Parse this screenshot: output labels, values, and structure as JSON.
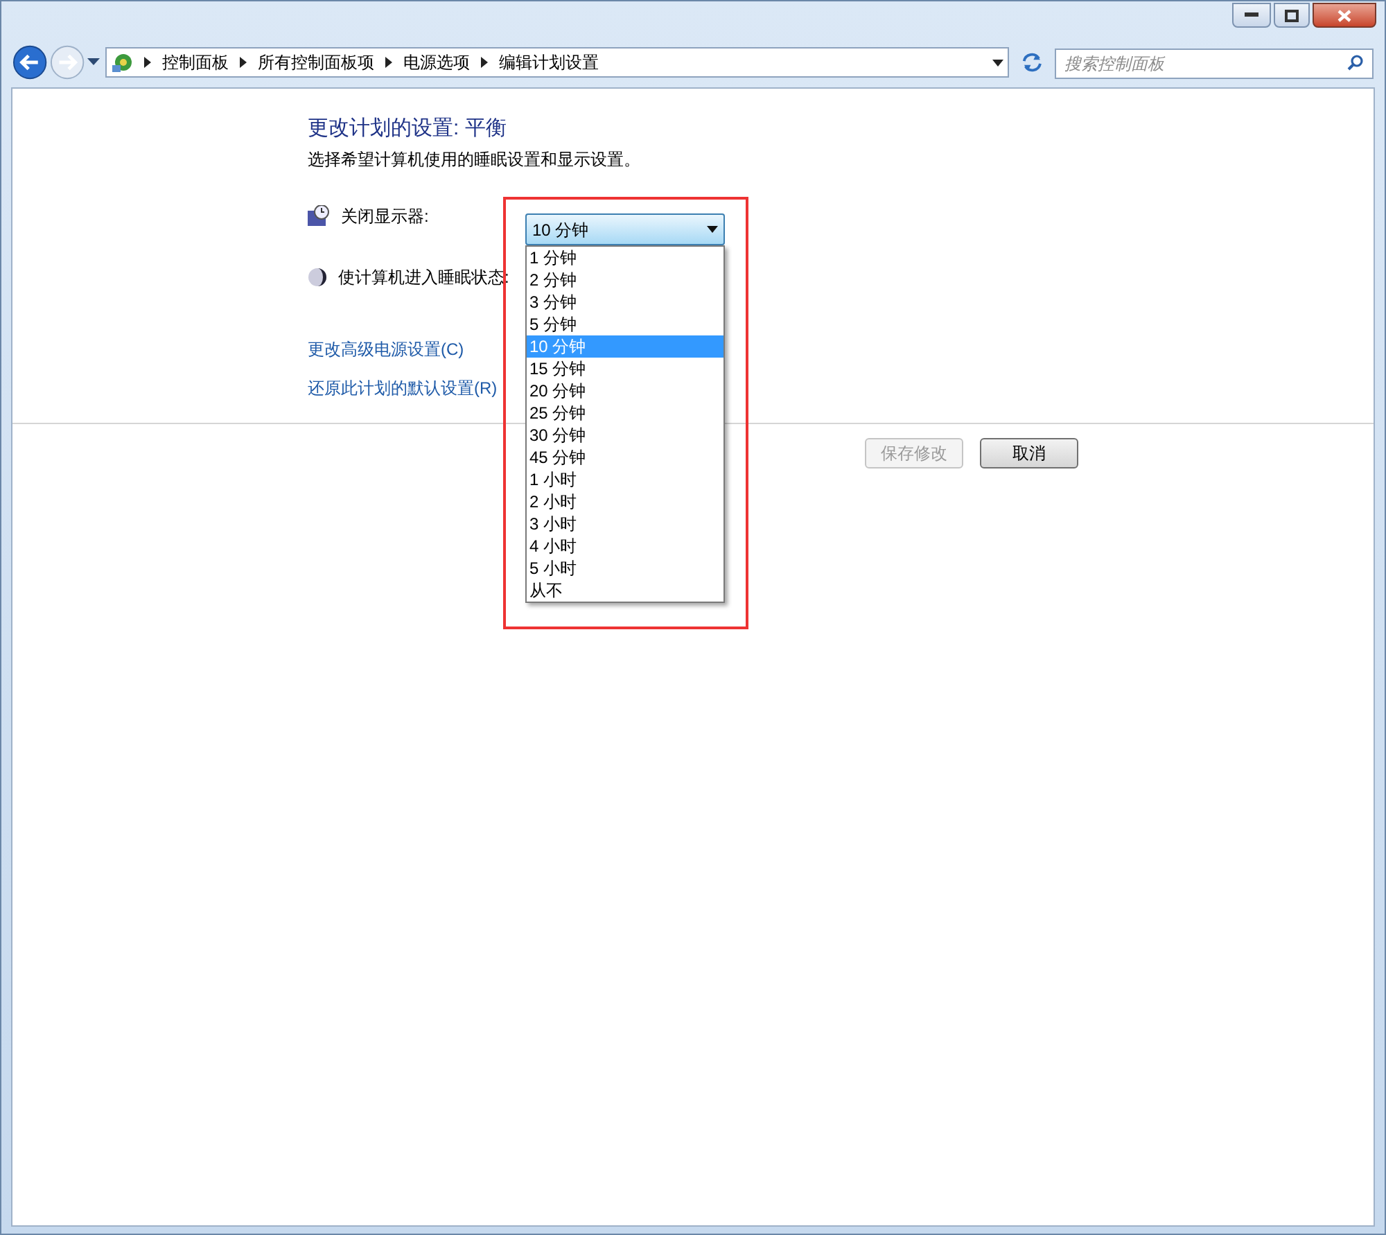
{
  "address_bar": {
    "crumbs": [
      "控制面板",
      "所有控制面板项",
      "电源选项",
      "编辑计划设置"
    ]
  },
  "search": {
    "placeholder": "搜索控制面板"
  },
  "page": {
    "title": "更改计划的设置: 平衡",
    "subtitle": "选择希望计算机使用的睡眠设置和显示设置。",
    "settings": [
      {
        "kind": "display",
        "label": "关闭显示器:",
        "value": "10 分钟"
      },
      {
        "kind": "sleep",
        "label": "使计算机进入睡眠状态:"
      }
    ],
    "links": [
      "更改高级电源设置(C)",
      "还原此计划的默认设置(R)"
    ],
    "buttons": [
      {
        "label": "保存修改",
        "disabled": true
      },
      {
        "label": "取消",
        "disabled": false
      }
    ]
  },
  "dropdown_list": {
    "expanded": true,
    "options": [
      {
        "label": "1 分钟",
        "selected": false
      },
      {
        "label": "2 分钟",
        "selected": false
      },
      {
        "label": "3 分钟",
        "selected": false
      },
      {
        "label": "5 分钟",
        "selected": false
      },
      {
        "label": "10 分钟",
        "selected": true
      },
      {
        "label": "15 分钟",
        "selected": false
      },
      {
        "label": "20 分钟",
        "selected": false
      },
      {
        "label": "25 分钟",
        "selected": false
      },
      {
        "label": "30 分钟",
        "selected": false
      },
      {
        "label": "45 分钟",
        "selected": false
      },
      {
        "label": "1 小时",
        "selected": false
      },
      {
        "label": "2 小时",
        "selected": false
      },
      {
        "label": "3 小时",
        "selected": false
      },
      {
        "label": "4 小时",
        "selected": false
      },
      {
        "label": "5 小时",
        "selected": false
      },
      {
        "label": "从不",
        "selected": false
      }
    ]
  }
}
